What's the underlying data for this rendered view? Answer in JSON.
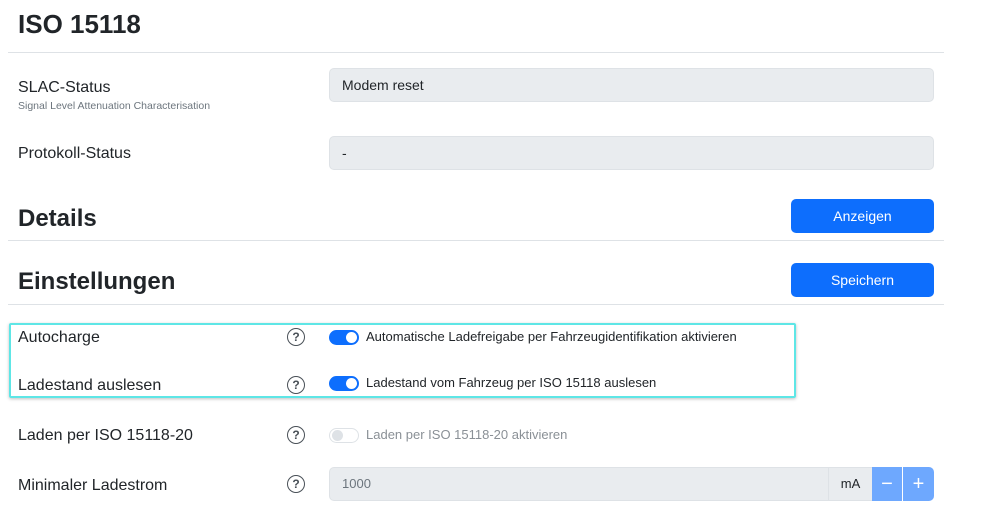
{
  "page": {
    "title": "ISO 15118"
  },
  "status": {
    "slac_label": "SLAC-Status",
    "slac_sublabel": "Signal Level Attenuation Characterisation",
    "slac_value": "Modem reset",
    "protocol_label": "Protokoll-Status",
    "protocol_value": "-"
  },
  "details": {
    "title": "Details",
    "button": "Anzeigen"
  },
  "settings": {
    "title": "Einstellungen",
    "save_button": "Speichern",
    "help_glyph": "?",
    "autocharge": {
      "label": "Autocharge",
      "toggle_text": "Automatische Ladefreigabe per Fahrzeugidentifikation aktivieren",
      "enabled": true
    },
    "soc": {
      "label": "Ladestand auslesen",
      "toggle_text": "Ladestand vom Fahrzeug per ISO 15118 auslesen",
      "enabled": true
    },
    "iso20": {
      "label": "Laden per ISO 15118-20",
      "toggle_text": "Laden per ISO 15118-20 aktivieren",
      "enabled": false
    },
    "min_current": {
      "label": "Minimaler Ladestrom",
      "placeholder": "1000",
      "unit": "mA",
      "minus": "−",
      "plus": "+"
    }
  },
  "colors": {
    "primary": "#0d6efd",
    "primary_disabled": "#6ea8fe",
    "highlight": "#5ee6e6"
  },
  "icons": {
    "help": "question-circle-icon"
  }
}
